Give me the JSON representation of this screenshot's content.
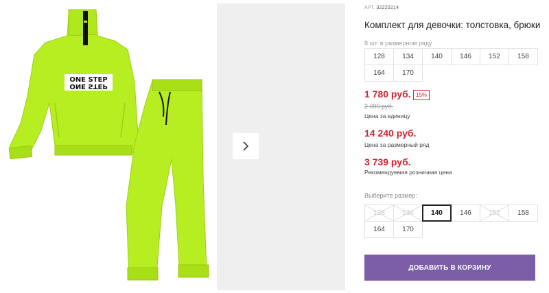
{
  "product": {
    "art_label": "АРТ.",
    "art_number": "32220214",
    "title": "Комплект для девочки: толстовка, брюки",
    "pack_hint": "8 шт. в размерном ряду",
    "pack_sizes": [
      "128",
      "134",
      "140",
      "146",
      "152",
      "158",
      "164",
      "170"
    ],
    "brand_print_top": "ONE STEP",
    "brand_print_bottom": "ONE STEP"
  },
  "pricing": {
    "unit_price": "1 780 руб.",
    "discount_badge": "15%",
    "old_price": "2 090 руб.",
    "unit_label": "Цена за единицу",
    "pack_price": "14 240 руб.",
    "pack_label": "Цена за размерный ряд",
    "retail_price": "3 739 руб.",
    "retail_label": "Рекомендуемая розничная цена"
  },
  "size_picker": {
    "label": "Выберите размер:",
    "sizes": [
      {
        "value": "128",
        "state": "disabled"
      },
      {
        "value": "134",
        "state": "disabled"
      },
      {
        "value": "140",
        "state": "selected"
      },
      {
        "value": "146",
        "state": "available"
      },
      {
        "value": "152",
        "state": "disabled"
      },
      {
        "value": "158",
        "state": "available"
      },
      {
        "value": "164",
        "state": "available"
      },
      {
        "value": "170",
        "state": "available"
      }
    ]
  },
  "actions": {
    "add_to_cart": "ДОБАВИТЬ В КОРЗИНУ"
  },
  "colors": {
    "accent": "#7b5ea7",
    "price_red": "#d4212e",
    "garment": "#b7ee22"
  },
  "icons": {
    "next": "chevron-right-icon"
  }
}
